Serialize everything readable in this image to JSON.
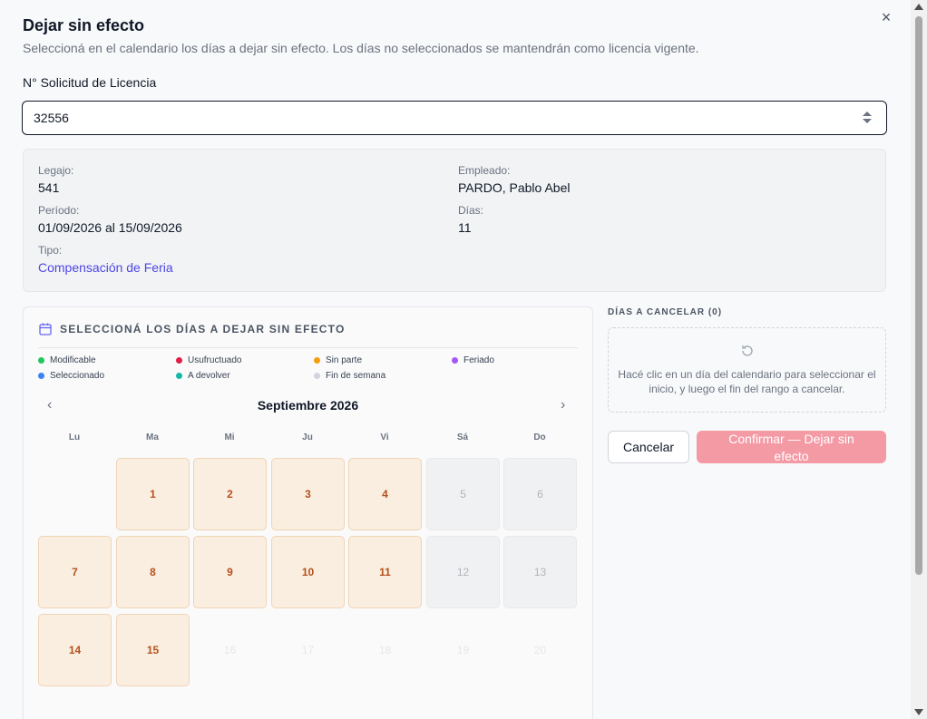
{
  "dialog": {
    "title": "Dejar sin efecto",
    "subtitle": "Seleccioná en el calendario los días a dejar sin efecto. Los días no seleccionados se mantendrán como licencia vigente.",
    "close_label": "×"
  },
  "request": {
    "label": "N° Solicitud de Licencia",
    "value": "32556"
  },
  "info": {
    "legajo_label": "Legajo:",
    "legajo_value": "541",
    "empleado_label": "Empleado:",
    "empleado_value": "PARDO, Pablo Abel",
    "periodo_label": "Período:",
    "periodo_value": "01/09/2026 al 15/09/2026",
    "dias_label": "Días:",
    "dias_value": "11",
    "tipo_label": "Tipo:",
    "tipo_value": "Compensación de Feria"
  },
  "calendar": {
    "heading": "SELECCIONÁ LOS DÍAS A DEJAR SIN EFECTO",
    "legend": [
      {
        "label": "Modificable",
        "color": "#22c55e"
      },
      {
        "label": "Usufructuado",
        "color": "#e11d48"
      },
      {
        "label": "Sin parte",
        "color": "#f59e0b"
      },
      {
        "label": "Feriado",
        "color": "#a855f7"
      },
      {
        "label": "Seleccionado",
        "color": "#3b82f6"
      },
      {
        "label": "A devolver",
        "color": "#14b8a6"
      },
      {
        "label": "Fin de semana",
        "color": "#d1d5db"
      }
    ],
    "month": "Septiembre 2026",
    "prev_icon": "‹",
    "next_icon": "›",
    "weekdays": [
      "Lu",
      "Ma",
      "Mi",
      "Ju",
      "Vi",
      "Sá",
      "Do"
    ],
    "days": [
      {
        "label": "1",
        "state": "mod"
      },
      {
        "label": "2",
        "state": "mod"
      },
      {
        "label": "3",
        "state": "mod"
      },
      {
        "label": "4",
        "state": "mod"
      },
      {
        "label": "5",
        "state": "we"
      },
      {
        "label": "6",
        "state": "we"
      },
      {
        "label": "7",
        "state": "mod"
      },
      {
        "label": "8",
        "state": "mod"
      },
      {
        "label": "9",
        "state": "mod"
      },
      {
        "label": "10",
        "state": "mod"
      },
      {
        "label": "11",
        "state": "mod"
      },
      {
        "label": "12",
        "state": "we"
      },
      {
        "label": "13",
        "state": "we"
      },
      {
        "label": "14",
        "state": "mod"
      },
      {
        "label": "15",
        "state": "mod"
      },
      {
        "label": "16",
        "state": "out"
      },
      {
        "label": "17",
        "state": "out"
      },
      {
        "label": "18",
        "state": "out"
      },
      {
        "label": "19",
        "state": "out"
      },
      {
        "label": "20",
        "state": "out"
      }
    ]
  },
  "selection": {
    "label": "DÍAS A CANCELAR (0)",
    "empty_text": "Hacé clic en un día del calendario para seleccionar el inicio, y luego el fin del rango a cancelar.",
    "cancel_label": "Cancelar",
    "confirm_label": "Confirmar — Dejar sin efecto"
  }
}
